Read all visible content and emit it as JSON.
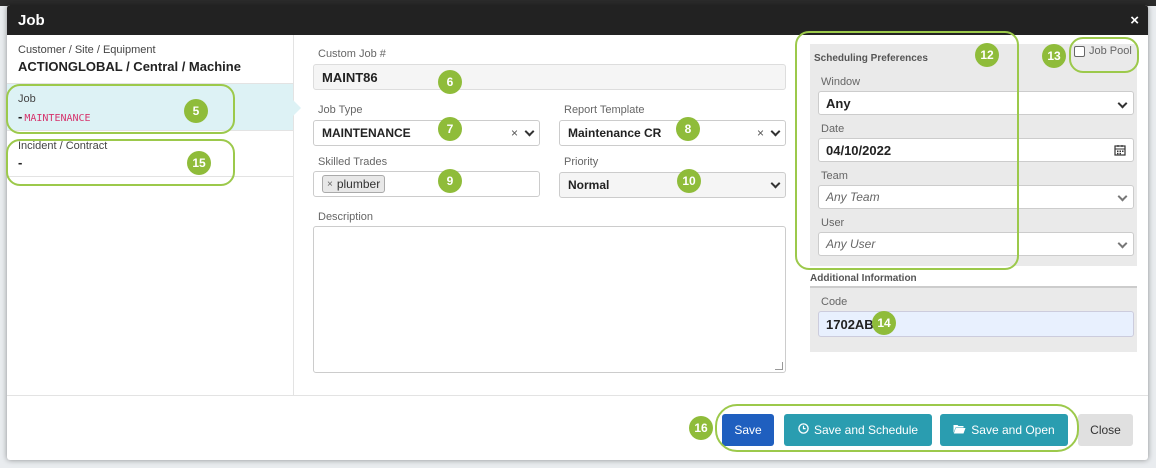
{
  "dialog": {
    "title": "Job",
    "close_glyph": "×"
  },
  "left": {
    "cse_label": "Customer / Site / Equipment",
    "cse_value": "ACTIONGLOBAL / Central / Machine",
    "job_label": "Job",
    "job_dash": "-",
    "job_value": "MAINTENANCE",
    "incident_label": "Incident / Contract",
    "incident_value": "-"
  },
  "form": {
    "custom_job_label": "Custom Job #",
    "custom_job_value": "MAINT86",
    "job_type_label": "Job Type",
    "job_type_value": "MAINTENANCE",
    "report_template_label": "Report Template",
    "report_template_value": "Maintenance CR",
    "skilled_trades_label": "Skilled Trades",
    "skilled_trades_tag": "plumber",
    "priority_label": "Priority",
    "priority_value": "Normal",
    "description_label": "Description",
    "clear_glyph": "×"
  },
  "scheduling": {
    "title": "Scheduling Preferences",
    "window_label": "Window",
    "window_value": "Any",
    "date_label": "Date",
    "date_value": "04/10/2022",
    "team_label": "Team",
    "team_placeholder": "Any Team",
    "user_label": "User",
    "user_placeholder": "Any User",
    "job_pool_label": "Job Pool"
  },
  "additional": {
    "title": "Additional Information",
    "code_label": "Code",
    "code_value": "1702AB"
  },
  "footer": {
    "save": "Save",
    "save_schedule": "Save and Schedule",
    "save_open": "Save and Open",
    "close": "Close"
  },
  "annotations": [
    "5",
    "6",
    "7",
    "8",
    "9",
    "10",
    "12",
    "13",
    "14",
    "15",
    "16"
  ],
  "colors": {
    "annotation": "#8fbc3a",
    "primary": "#1f5fbf",
    "teal": "#2a9db0",
    "header": "#222222"
  }
}
